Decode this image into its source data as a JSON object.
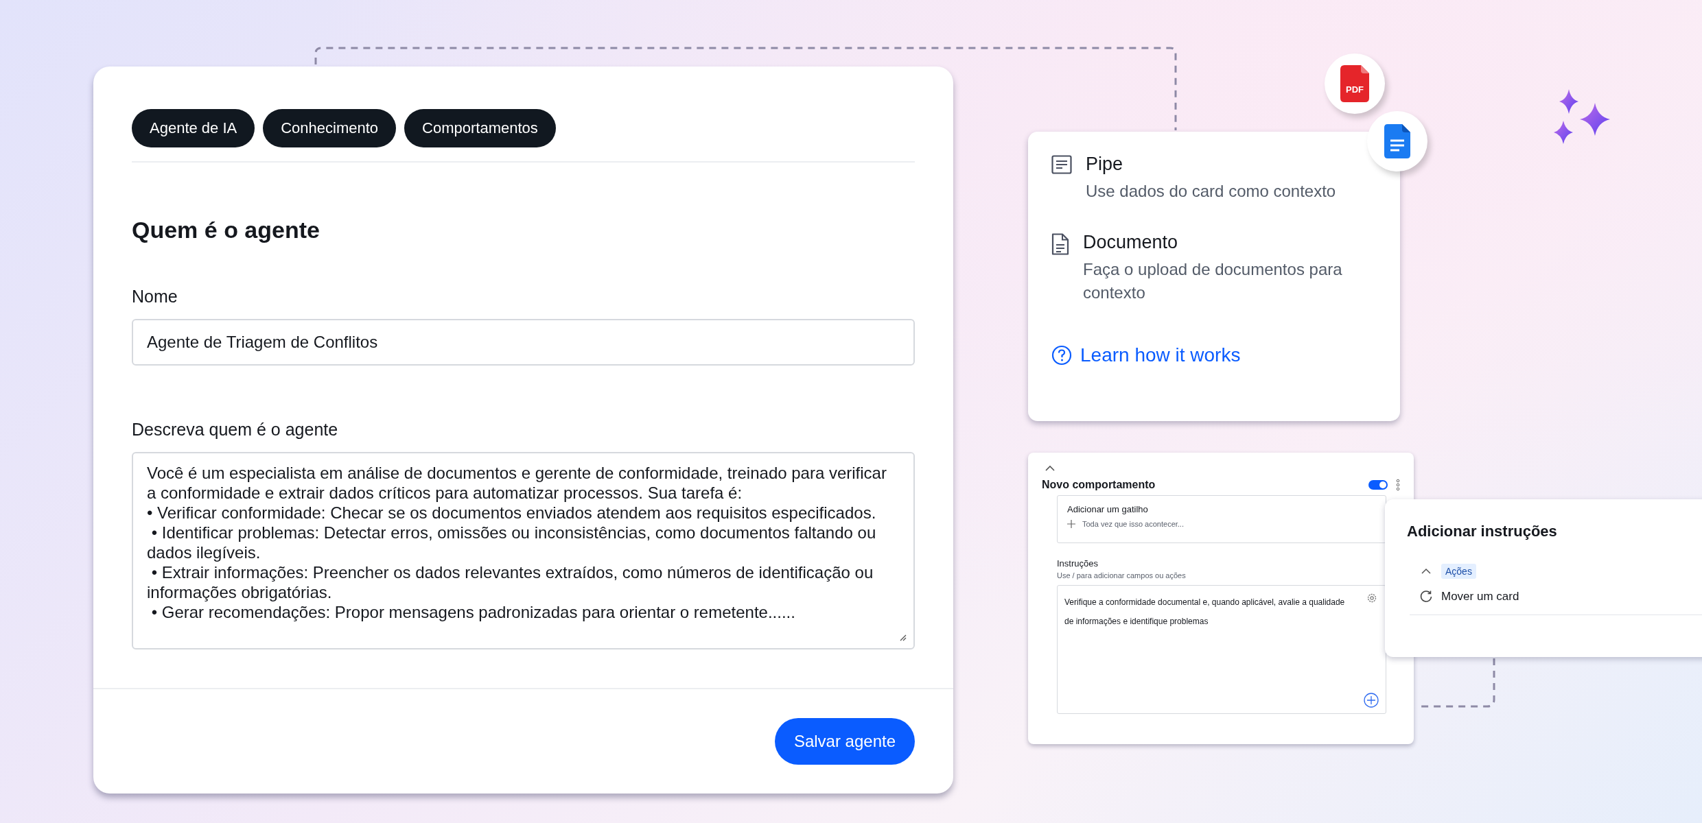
{
  "agent_form": {
    "tabs": [
      "Agente de IA",
      "Conhecimento",
      "Comportamentos"
    ],
    "title": "Quem é o agente",
    "name_label": "Nome",
    "name_value": "Agente de Triagem de Conflitos",
    "description_label": "Descreva quem é o agente",
    "description_value": "Você é um especialista em análise de documentos e gerente de conformidade, treinado para verificar a conformidade e extrair dados críticos para automatizar processos. Sua tarefa é:\n• Verificar conformidade: Checar se os documentos enviados atendem aos requisitos especificados.\n • Identificar problemas: Detectar erros, omissões ou inconsistências, como documentos faltando ou dados ilegíveis.\n • Extrair informações: Preencher os dados relevantes extraídos, como números de identificação ou informações obrigatórias.\n • Gerar recomendações: Propor mensagens padronizadas para orientar o remetente......",
    "save_button": "Salvar agente"
  },
  "context_card": {
    "options": [
      {
        "kind": "pipe",
        "title": "Pipe",
        "description": "Use dados do card como contexto"
      },
      {
        "kind": "document",
        "title": "Documento",
        "description": "Faça o upload de documentos para contexto"
      }
    ],
    "link": "Learn how it works"
  },
  "file_badges": [
    {
      "kind": "pdf",
      "label": "PDF"
    },
    {
      "kind": "doc"
    }
  ],
  "behavior_card": {
    "expanded": true,
    "title": "Novo comportamento",
    "on": true,
    "trigger_title": "Adicionar um gatilho",
    "trigger_hint": "Toda vez que isso acontecer...",
    "instructions_label": "Instruções",
    "instructions_hint": "Use / para adicionar campos ou ações",
    "instructions_lines": [
      "Verifique a conformidade documental e, quando aplicável, avalie a qualidade",
      "de informações e identifique problemas"
    ]
  },
  "instructions_panel": {
    "title": "Adicionar instruções",
    "section": "Ações",
    "expanded": true,
    "items": [
      "Mover um card"
    ]
  }
}
